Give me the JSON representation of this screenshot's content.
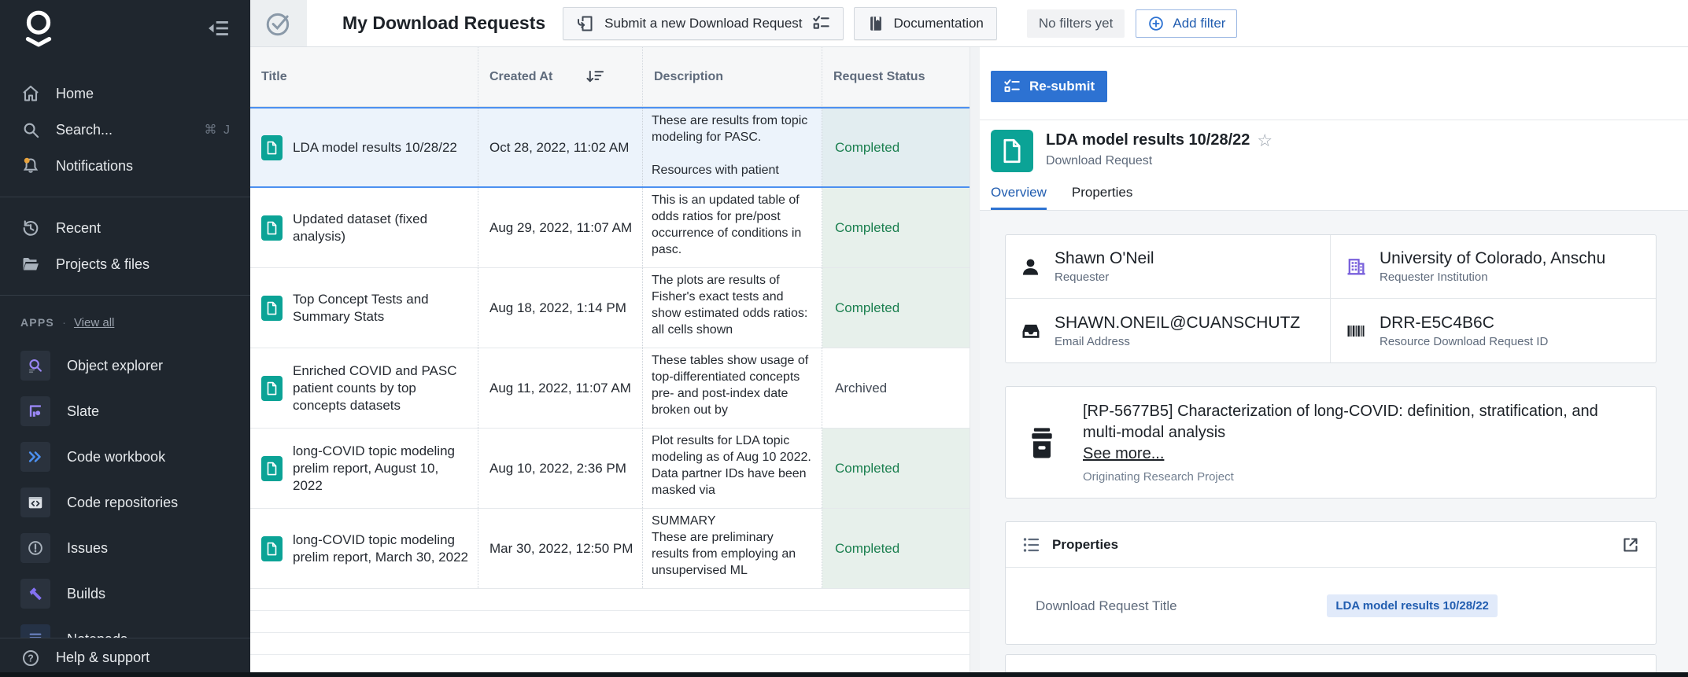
{
  "colors": {
    "accent_blue": "#2d72d2",
    "link_blue": "#215db0",
    "teal_document": "#0ba396",
    "green_completed": "#1c8050",
    "purple_institution": "#7961db",
    "sidebar_bg": "#1f262e",
    "selected_row_bg": "#ecf3fb"
  },
  "icons": {
    "star": "☆",
    "dot_separator": "·",
    "help": "?"
  },
  "sidebar": {
    "nav": [
      {
        "label": "Home"
      },
      {
        "label": "Search...",
        "shortcut": "⌘ J"
      },
      {
        "label": "Notifications"
      }
    ],
    "nav2": [
      {
        "label": "Recent"
      },
      {
        "label": "Projects & files"
      }
    ],
    "apps_header": {
      "label": "APPS",
      "view_all": "View all"
    },
    "apps": [
      {
        "label": "Object explorer"
      },
      {
        "label": "Slate"
      },
      {
        "label": "Code workbook"
      },
      {
        "label": "Code repositories"
      },
      {
        "label": "Issues"
      },
      {
        "label": "Builds"
      },
      {
        "label": "Notepads"
      }
    ],
    "footer": {
      "label": "Help & support"
    }
  },
  "topbar": {
    "title": "My Download Requests",
    "submit_button": "Submit a new Download Request",
    "documentation_button": "Documentation",
    "no_filters_chip": "No filters yet",
    "add_filter_button": "Add filter"
  },
  "table": {
    "columns": [
      "Title",
      "Created At",
      "Description",
      "Request Status"
    ],
    "rows": [
      {
        "title": "LDA model results 10/28/22",
        "created_at": "Oct 28, 2022, 11:02 AM",
        "description": "These are results from topic modeling for PASC.\n\nResources with patient",
        "status": "Completed",
        "selected": true
      },
      {
        "title": "Updated dataset (fixed analysis)",
        "created_at": "Aug 29, 2022, 11:07 AM",
        "description": "This is an updated table of odds ratios for pre/post occurrence of conditions in pasc.",
        "status": "Completed"
      },
      {
        "title": "Top Concept Tests and Summary Stats",
        "created_at": "Aug 18, 2022, 1:14 PM",
        "description": "The plots are results of Fisher's exact tests and show estimated odds ratios: all cells shown",
        "status": "Completed"
      },
      {
        "title": "Enriched COVID and PASC patient counts by top concepts datasets",
        "created_at": "Aug 11, 2022, 11:07 AM",
        "description": "These tables show usage of top-differentiated concepts pre- and post-index date broken out by",
        "status": "Archived"
      },
      {
        "title": "long-COVID topic modeling prelim report, August 10, 2022",
        "created_at": "Aug 10, 2022, 2:36 PM",
        "description": "Plot results for LDA topic modeling as of Aug 10 2022. Data partner IDs have been masked via",
        "status": "Completed"
      },
      {
        "title": "long-COVID topic modeling prelim report, March 30, 2022",
        "created_at": "Mar 30, 2022, 12:50 PM",
        "description": "SUMMARY\nThese are preliminary results from employing an unsupervised ML",
        "status": "Completed"
      }
    ]
  },
  "detail": {
    "resubmit_button": "Re-submit",
    "title": "LDA model results 10/28/22",
    "subtitle": "Download Request",
    "tabs": [
      {
        "label": "Overview"
      },
      {
        "label": "Properties"
      }
    ],
    "cards": [
      {
        "value": "Shawn O'Neil",
        "label": "Requester"
      },
      {
        "value": "University of Colorado, Anschu",
        "label": "Requester Institution"
      },
      {
        "value": "SHAWN.ONEIL@CUANSCHUTZ",
        "label": "Email Address"
      },
      {
        "value": "DRR-E5C4B6C",
        "label": "Resource Download Request ID"
      }
    ],
    "project": {
      "title": "[RP-5677B5] Characterization of long-COVID: definition, stratification, and multi-modal analysis",
      "see_more": "See more...",
      "label": "Originating Research Project"
    },
    "properties": {
      "header": "Properties",
      "rows": [
        {
          "label": "Download Request Title",
          "value": "LDA model results 10/28/22"
        }
      ]
    }
  }
}
